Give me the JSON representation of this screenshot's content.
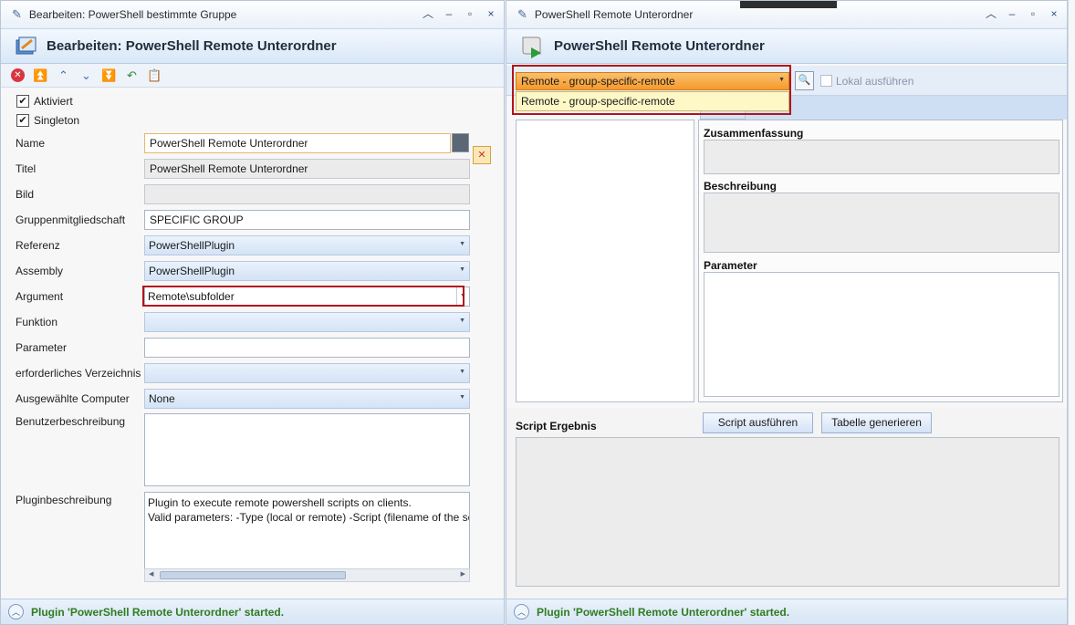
{
  "left": {
    "window_title": "Bearbeiten: PowerShell bestimmte Gruppe",
    "header_title": "Bearbeiten: PowerShell Remote Unterordner",
    "checkboxes": [
      {
        "label": "Aktiviert",
        "checked": true
      },
      {
        "label": "Singleton",
        "checked": true
      }
    ],
    "fields": {
      "name": {
        "label": "Name",
        "value": "PowerShell Remote Unterordner"
      },
      "titel": {
        "label": "Titel",
        "value": "PowerShell Remote Unterordner"
      },
      "bild": {
        "label": "Bild",
        "value": ""
      },
      "gruppe": {
        "label": "Gruppenmitgliedschaft",
        "value": "SPECIFIC GROUP"
      },
      "referenz": {
        "label": "Referenz",
        "value": "PowerShellPlugin"
      },
      "assembly": {
        "label": "Assembly",
        "value": "PowerShellPlugin"
      },
      "argument": {
        "label": "Argument",
        "value": "Remote\\subfolder"
      },
      "funktion": {
        "label": "Funktion",
        "value": ""
      },
      "parameter": {
        "label": "Parameter",
        "value": ""
      },
      "verzeichnis": {
        "label": "erforderliches Verzeichnis",
        "value": ""
      },
      "computer": {
        "label": "Ausgewählte Computer",
        "value": "None"
      },
      "benutzer": {
        "label": "Benutzerbeschreibung",
        "value": ""
      },
      "plugin": {
        "label": "Pluginbeschreibung",
        "line1": "Plugin to execute remote powershell scripts on clients.",
        "line2": "Valid parameters: -Type (local or remote) -Script (filename of the sc"
      }
    },
    "status": "Plugin 'PowerShell Remote Unterordner' started."
  },
  "right": {
    "window_title": "PowerShell Remote Unterordner",
    "header_title": "PowerShell Remote Unterordner",
    "remote_select": "Remote - group-specific-remote",
    "dropdown_option": "Remote - group-specific-remote",
    "lokal_label": "Lokal ausführen",
    "zusammenfassung": "Zusammenfassung",
    "beschreibung": "Beschreibung",
    "parameter": "Parameter",
    "script_ergebnis": "Script Ergebnis",
    "btn_script": "Script ausführen",
    "btn_tabelle": "Tabelle generieren",
    "status": "Plugin 'PowerShell Remote Unterordner' started."
  },
  "colors": {
    "accent_orange": "#f59a2e",
    "status_green": "#2e7d1f",
    "highlight_red": "#b0151c"
  }
}
